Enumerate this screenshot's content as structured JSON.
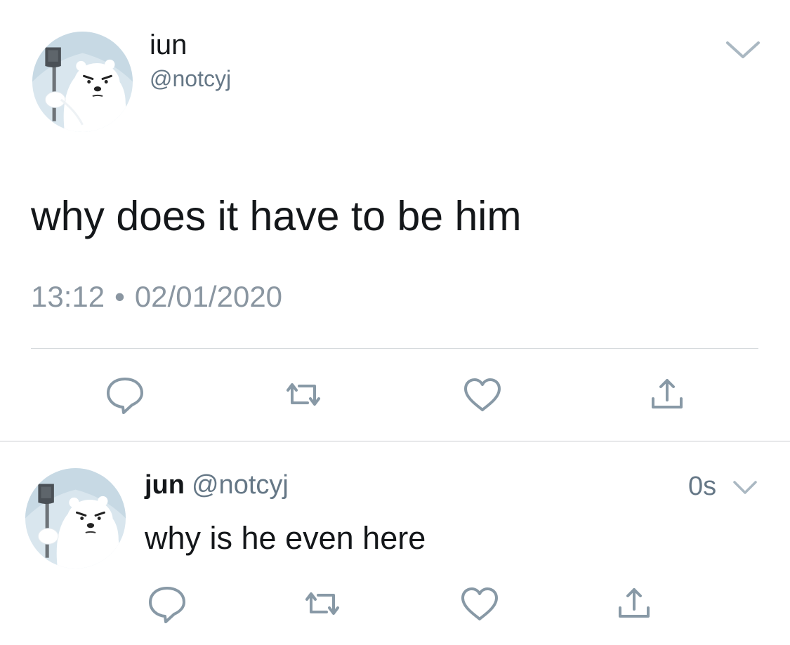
{
  "tweet": {
    "display_name": "iun",
    "handle": "@notcyj",
    "text": "why does it have to be him",
    "time": "13:12",
    "separator": "•",
    "date": "02/01/2020",
    "avatar_icon": "polar-bear-with-axe-avatar",
    "actions": [
      "reply-icon",
      "retweet-icon",
      "like-icon",
      "share-icon"
    ]
  },
  "reply": {
    "display_name": "jun",
    "handle": "@notcyj",
    "timestamp": "0s",
    "text": "why is he even here",
    "avatar_icon": "polar-bear-with-axe-avatar",
    "actions": [
      "reply-icon",
      "retweet-icon",
      "like-icon",
      "share-icon"
    ]
  },
  "colors": {
    "text_primary": "#14171a",
    "text_secondary": "#657786",
    "icon_gray": "#8899a6",
    "divider": "#d6dadd"
  }
}
